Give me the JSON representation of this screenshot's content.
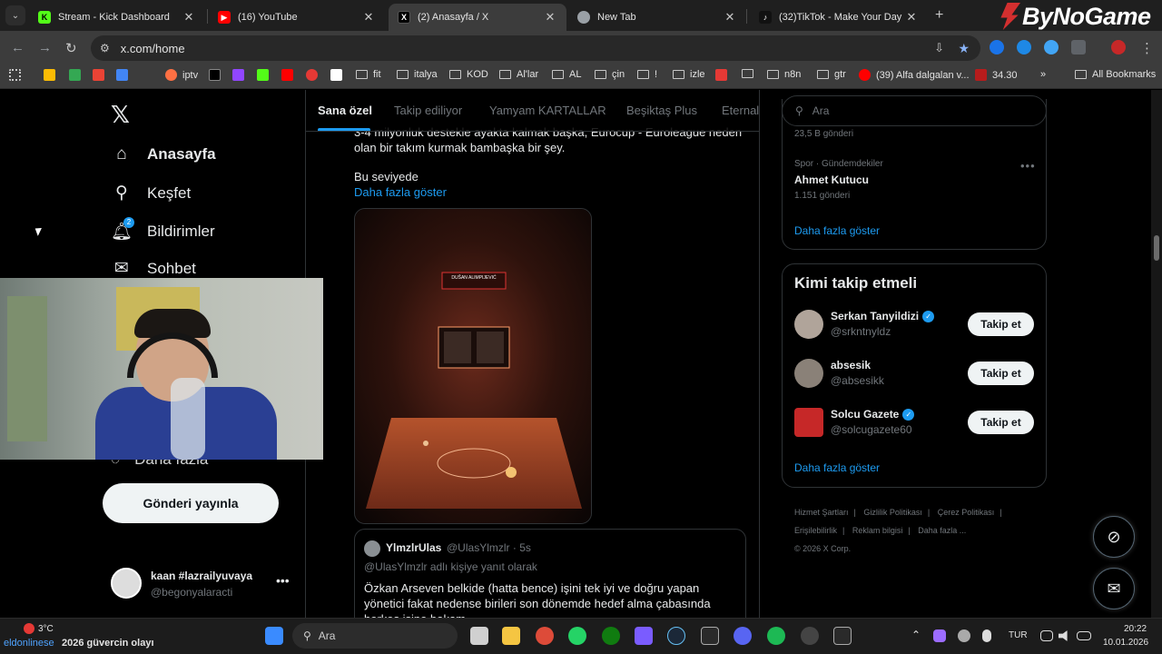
{
  "browser": {
    "tabs": [
      {
        "title": "Stream - Kick Dashboard",
        "active": false
      },
      {
        "title": "(16) YouTube",
        "active": false
      },
      {
        "title": "(2) Anasayfa / X",
        "active": true
      },
      {
        "title": "New Tab",
        "active": false
      },
      {
        "title": "(32)TikTok - Make Your Day",
        "active": false
      }
    ],
    "url": "x.com/home",
    "brand_overlay": "ByNoGame",
    "bookmarks": [
      "iptv",
      "fit",
      "italya",
      "KOD",
      "Al'lar",
      "AL",
      "çin",
      "!",
      "izle",
      "n8n",
      "gtr",
      "(39) Alfa dalgalan v...",
      "34.30"
    ],
    "all_bookmarks": "All Bookmarks"
  },
  "x": {
    "nav": {
      "items": [
        "Anasayfa",
        "Keşfet",
        "Bildirimler",
        "Sohbet"
      ],
      "more": "Daha fazla",
      "notif_count": "2",
      "post_button": "Gönderi yayınla"
    },
    "account": {
      "name": "kaan #lazrailyuvaya",
      "handle": "@begonyalaracti"
    },
    "timeline_tabs": [
      "Sana özel",
      "Takip ediliyor",
      "Yamyam KARTALLAR",
      "Beşiktaş Plus",
      "Eternal"
    ],
    "tweet": {
      "line1": "3-4 milyonluk destekle ayakta kalmak başka, Eurocup - Euroleague neden",
      "line2": "olan bir takım kurmak bambaşka bir şey.",
      "line3": "Bu seviyede",
      "show_more": "Daha fazla göster",
      "image_caption": "DUŠAN ALIMPIJEVIĆ"
    },
    "quote": {
      "name": "YlmzlrUlas",
      "handle": "@UlasYlmzlr",
      "time": "5s",
      "reply_to": "@UlasYlmzlr adlı kişiye yanıt olarak",
      "body": "Özkan Arseven belkide (hatta bence) işini tek iyi ve doğru yapan yönetici fakat nedense birileri son dönemde hedef alma çabasında herkes işine bakam"
    },
    "search_placeholder": "Ara",
    "trends": {
      "top_count": "23,5 B gönderi",
      "items": [
        {
          "category": "Spor · Gündemdekiler",
          "name": "Ahmet Kutucu",
          "count": "1.151 gönderi"
        }
      ],
      "show_more": "Daha fazla göster"
    },
    "who_to_follow": {
      "title": "Kimi takip etmeli",
      "people": [
        {
          "name": "Serkan Tanyildizi",
          "handle": "@srkntnyldz",
          "verified": true,
          "button": "Takip et"
        },
        {
          "name": "absesik",
          "handle": "@absesikk",
          "verified": false,
          "button": "Takip et"
        },
        {
          "name": "Solcu Gazete",
          "handle": "@solcugazete60",
          "verified": true,
          "button": "Takip et"
        }
      ],
      "show_more": "Daha fazla göster"
    },
    "footer": [
      "Hizmet Şartları",
      "|",
      "Gizlilik Politikası",
      "|",
      "Çerez Politikası",
      "|",
      "Erişilebilirlik",
      "|",
      "Reklam bilgisi",
      "|",
      "Daha fazla ...",
      "© 2026 X Corp."
    ]
  },
  "taskbar": {
    "weather_temp": "3°C",
    "ticker": "2026 güvercin olayı",
    "ticker_prefix": "eldonlinese",
    "search": "Ara",
    "lang": "TUR",
    "time": "20:22",
    "date": "10.01.2026"
  }
}
